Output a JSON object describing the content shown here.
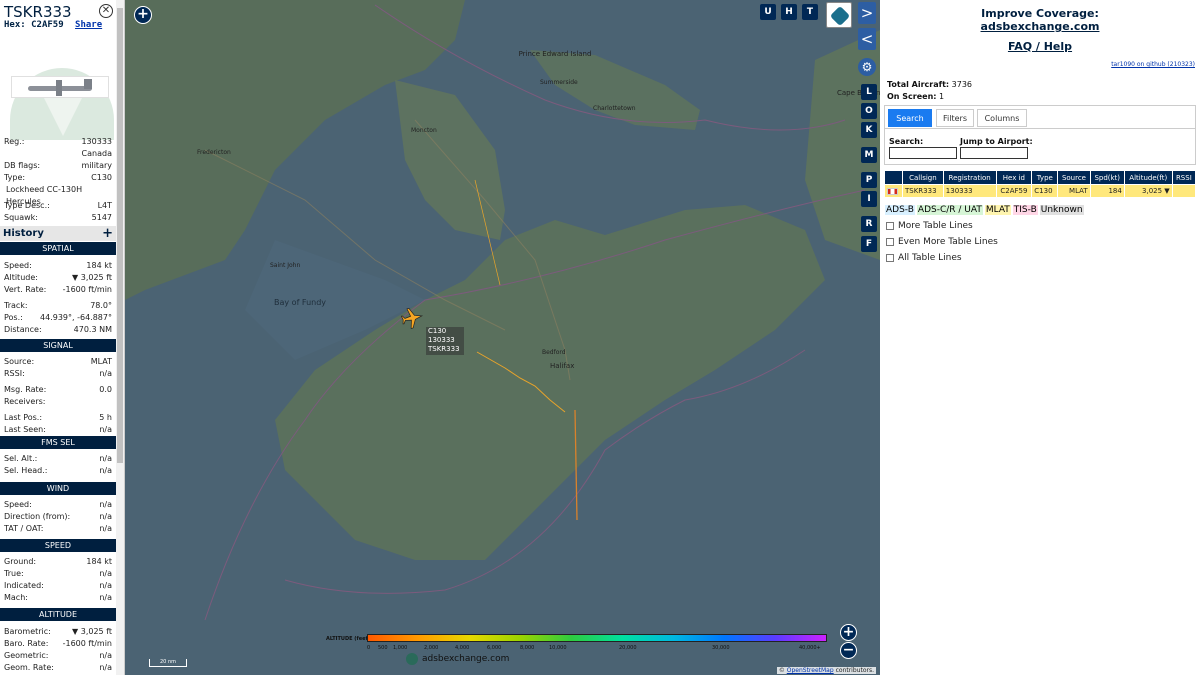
{
  "aircraft": {
    "callsign": "TSKR333",
    "hex_label": "Hex:",
    "hex": "C2AF59",
    "share": "Share",
    "reg_label": "Reg.:",
    "reg": "130333",
    "country": "Canada",
    "db_flags_label": "DB flags:",
    "db_flags": "military",
    "type_label": "Type:",
    "type": "C130",
    "type_name": "Lockheed CC-130H Hercules",
    "type_desc_label": "Type Desc.:",
    "type_desc": "L4T",
    "squawk_label": "Squawk:",
    "squawk": "5147"
  },
  "history": {
    "label": "History",
    "plus": "+"
  },
  "spatial": {
    "title": "SPATIAL",
    "rows": [
      {
        "k": "Speed:",
        "v": "184 kt"
      },
      {
        "k": "Altitude:",
        "v": "▼ 3,025 ft"
      },
      {
        "k": "Vert. Rate:",
        "v": "-1600 ft/min"
      },
      {
        "k": "Track:",
        "v": "78.0°"
      },
      {
        "k": "Pos.:",
        "v": "44.939°, -64.887°"
      },
      {
        "k": "Distance:",
        "v": "470.3 NM"
      }
    ]
  },
  "signal": {
    "title": "SIGNAL",
    "rows": [
      {
        "k": "Source:",
        "v": "MLAT"
      },
      {
        "k": "RSSI:",
        "v": "n/a"
      },
      {
        "k": "Msg. Rate:",
        "v": "0.0"
      },
      {
        "k": "Receivers:",
        "v": ""
      },
      {
        "k": "Last Pos.:",
        "v": "5 h"
      },
      {
        "k": "Last Seen:",
        "v": "n/a"
      }
    ]
  },
  "fms": {
    "title": "FMS SEL",
    "rows": [
      {
        "k": "Sel. Alt.:",
        "v": "n/a"
      },
      {
        "k": "Sel. Head.:",
        "v": "n/a"
      }
    ]
  },
  "wind": {
    "title": "WIND",
    "rows": [
      {
        "k": "Speed:",
        "v": "n/a"
      },
      {
        "k": "Direction (from):",
        "v": "n/a"
      },
      {
        "k": "TAT / OAT:",
        "v": "n/a"
      }
    ]
  },
  "speed": {
    "title": "SPEED",
    "rows": [
      {
        "k": "Ground:",
        "v": "184 kt"
      },
      {
        "k": "True:",
        "v": "n/a"
      },
      {
        "k": "Indicated:",
        "v": "n/a"
      },
      {
        "k": "Mach:",
        "v": "n/a"
      }
    ]
  },
  "altitude": {
    "title": "ALTITUDE",
    "rows": [
      {
        "k": "Barometric:",
        "v": "▼ 3,025 ft"
      },
      {
        "k": "Baro. Rate:",
        "v": "-1600 ft/min"
      },
      {
        "k": "Geometric:",
        "v": "n/a"
      },
      {
        "k": "Geom. Rate:",
        "v": "n/a"
      }
    ]
  },
  "map": {
    "buttons": [
      "U",
      "H",
      "T"
    ],
    "side_buttons": [
      "L",
      "O",
      "K",
      "M",
      "P",
      "I",
      "R",
      "F"
    ],
    "label_lines": [
      "C130",
      "130333",
      "TSKR333"
    ],
    "place_labels": [
      {
        "name": "Prince Edward Island"
      },
      {
        "name": "Summerside"
      },
      {
        "name": "Charlottetown"
      },
      {
        "name": "Moncton"
      },
      {
        "name": "Fredericton"
      },
      {
        "name": "Saint John"
      },
      {
        "name": "Bay of Fundy"
      },
      {
        "name": "Halifax"
      },
      {
        "name": "Bedford"
      },
      {
        "name": "Cape Breton Island"
      }
    ],
    "altitude_title": "ALTITUDE (feet)",
    "altitude_ticks": [
      "0",
      "500",
      "1,000",
      "2,000",
      "4,000",
      "6,000",
      "8,000",
      "10,000",
      "20,000",
      "30,000",
      "40,000+"
    ],
    "scale": "20 nm",
    "brand": "adsbexchange.com",
    "attribution_pre": "©",
    "attribution_link": "OpenStreetMap",
    "attribution_post": "contributors."
  },
  "right": {
    "improve": "Improve Coverage:",
    "improve_link": "adsbexchange.com",
    "faq": "FAQ / Help",
    "github": "tar1090 on github (210323)",
    "total_label": "Total Aircraft:",
    "total": "3736",
    "onscreen_label": "On Screen:",
    "onscreen": "1",
    "tabs": [
      "Search",
      "Filters",
      "Columns"
    ],
    "search_label": "Search:",
    "airport_label": "Jump to Airport:",
    "columns": [
      "",
      "Callsign",
      "Registration",
      "Hex id",
      "Type",
      "Source",
      "Spd(kt)",
      "Altitude(ft)",
      "RSSI"
    ],
    "row": [
      "",
      "TSKR333",
      "130333",
      "C2AF59",
      "C130",
      "MLAT",
      "184",
      "3,025 ▼",
      ""
    ],
    "legend": [
      {
        "label": "ADS-B",
        "color": "#d8f0ff"
      },
      {
        "label": "ADS-C/R / UAT",
        "color": "#d6f5d6"
      },
      {
        "label": "MLAT",
        "color": "#fff5b0"
      },
      {
        "label": "TIS-B",
        "color": "#ffd6e6"
      },
      {
        "label": "Unknown",
        "color": "#e0e0e0"
      }
    ],
    "checkboxes": [
      "More Table Lines",
      "Even More Table Lines",
      "All Table Lines"
    ]
  }
}
